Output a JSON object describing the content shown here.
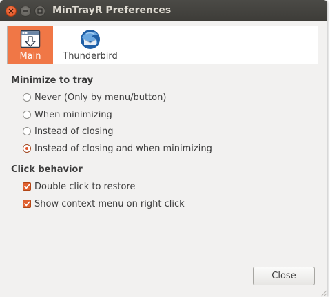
{
  "window": {
    "title": "MinTrayR Preferences"
  },
  "pages": [
    {
      "label": "Main",
      "icon": "tray-minimize-icon",
      "selected": true
    },
    {
      "label": "Thunderbird",
      "icon": "thunderbird-icon",
      "selected": false
    }
  ],
  "minimize": {
    "heading": "Minimize to tray",
    "options": [
      {
        "label": "Never (Only by menu/button)",
        "selected": false
      },
      {
        "label": "When minimizing",
        "selected": false
      },
      {
        "label": "Instead of closing",
        "selected": false
      },
      {
        "label": "Instead of closing and when minimizing",
        "selected": true
      }
    ]
  },
  "click": {
    "heading": "Click behavior",
    "options": [
      {
        "label": "Double click to restore",
        "checked": true
      },
      {
        "label": "Show context menu on right click",
        "checked": true
      }
    ]
  },
  "footer": {
    "close_label": "Close"
  },
  "colors": {
    "accent": "#f07746",
    "titlebar": "#3d3c38",
    "window_bg": "#f2f1f0"
  }
}
